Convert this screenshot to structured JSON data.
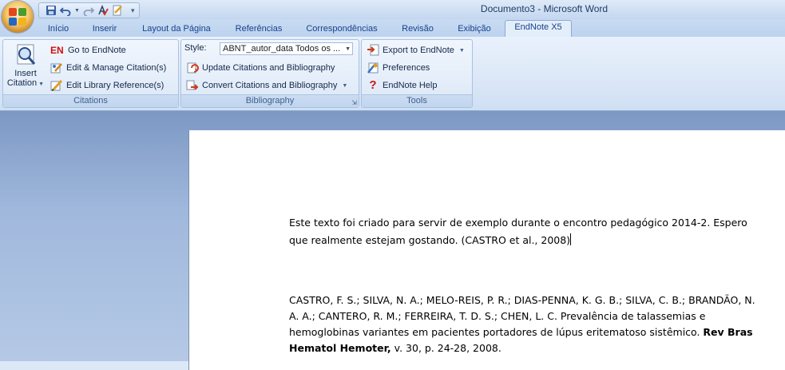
{
  "window": {
    "title": "Documento3 - Microsoft Word"
  },
  "tabs": [
    {
      "label": "Início"
    },
    {
      "label": "Inserir"
    },
    {
      "label": "Layout da Página"
    },
    {
      "label": "Referências"
    },
    {
      "label": "Correspondências"
    },
    {
      "label": "Revisão"
    },
    {
      "label": "Exibição"
    },
    {
      "label": "EndNote X5",
      "active": true
    }
  ],
  "ribbon": {
    "citations": {
      "insert_citation_line1": "Insert",
      "insert_citation_line2": "Citation",
      "go_to_endnote": "Go to EndNote",
      "go_to_endnote_badge": "EN",
      "edit_manage": "Edit & Manage Citation(s)",
      "edit_library": "Edit Library Reference(s)",
      "label": "Citations"
    },
    "bibliography": {
      "style_label": "Style:",
      "style_value": "ABNT_autor_data Todos os ...",
      "update": "Update Citations and Bibliography",
      "convert": "Convert Citations and Bibliography",
      "label": "Bibliography"
    },
    "tools": {
      "export": "Export to EndNote",
      "preferences": "Preferences",
      "help": "EndNote Help",
      "label": "Tools"
    }
  },
  "document": {
    "paragraph1_line1": "Este texto foi criado para servir de exemplo durante o encontro pedagógico 2014-2. Espero",
    "paragraph1_line2": "que realmente estejam gostando. (CASTRO et al., 2008)",
    "reference_line1": "CASTRO, F. S.; SILVA, N. A.; MELO-REIS, P. R.; DIAS-PENNA, K. G. B.; SILVA, C. B.; BRANDÃO, N.",
    "reference_line2": "A. A.; CANTERO, R. M.; FERREIRA, T. D. S.; CHEN, L. C. Prevalência de talassemias e",
    "reference_line3": "hemoglobinas variantes em pacientes portadores de lúpus eritematoso sistêmico.",
    "reference_journal": "Rev Bras",
    "reference_journal2": "Hematol Hemoter,",
    "reference_tail": " v. 30, p. 24-28,  2008."
  }
}
